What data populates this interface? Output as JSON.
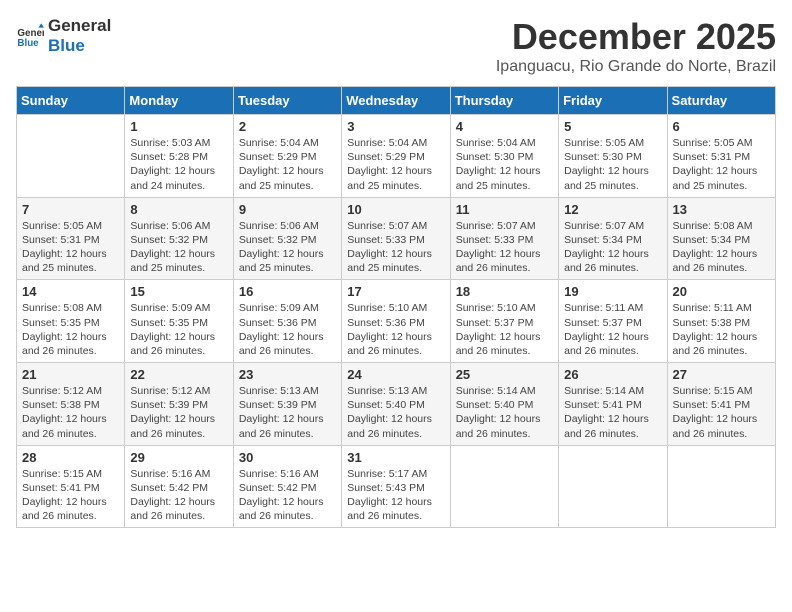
{
  "logo": {
    "line1": "General",
    "line2": "Blue"
  },
  "title": "December 2025",
  "location": "Ipanguacu, Rio Grande do Norte, Brazil",
  "header_days": [
    "Sunday",
    "Monday",
    "Tuesday",
    "Wednesday",
    "Thursday",
    "Friday",
    "Saturday"
  ],
  "weeks": [
    [
      {
        "day": "",
        "info": ""
      },
      {
        "day": "1",
        "info": "Sunrise: 5:03 AM\nSunset: 5:28 PM\nDaylight: 12 hours\nand 24 minutes."
      },
      {
        "day": "2",
        "info": "Sunrise: 5:04 AM\nSunset: 5:29 PM\nDaylight: 12 hours\nand 25 minutes."
      },
      {
        "day": "3",
        "info": "Sunrise: 5:04 AM\nSunset: 5:29 PM\nDaylight: 12 hours\nand 25 minutes."
      },
      {
        "day": "4",
        "info": "Sunrise: 5:04 AM\nSunset: 5:30 PM\nDaylight: 12 hours\nand 25 minutes."
      },
      {
        "day": "5",
        "info": "Sunrise: 5:05 AM\nSunset: 5:30 PM\nDaylight: 12 hours\nand 25 minutes."
      },
      {
        "day": "6",
        "info": "Sunrise: 5:05 AM\nSunset: 5:31 PM\nDaylight: 12 hours\nand 25 minutes."
      }
    ],
    [
      {
        "day": "7",
        "info": "Sunrise: 5:05 AM\nSunset: 5:31 PM\nDaylight: 12 hours\nand 25 minutes."
      },
      {
        "day": "8",
        "info": "Sunrise: 5:06 AM\nSunset: 5:32 PM\nDaylight: 12 hours\nand 25 minutes."
      },
      {
        "day": "9",
        "info": "Sunrise: 5:06 AM\nSunset: 5:32 PM\nDaylight: 12 hours\nand 25 minutes."
      },
      {
        "day": "10",
        "info": "Sunrise: 5:07 AM\nSunset: 5:33 PM\nDaylight: 12 hours\nand 25 minutes."
      },
      {
        "day": "11",
        "info": "Sunrise: 5:07 AM\nSunset: 5:33 PM\nDaylight: 12 hours\nand 26 minutes."
      },
      {
        "day": "12",
        "info": "Sunrise: 5:07 AM\nSunset: 5:34 PM\nDaylight: 12 hours\nand 26 minutes."
      },
      {
        "day": "13",
        "info": "Sunrise: 5:08 AM\nSunset: 5:34 PM\nDaylight: 12 hours\nand 26 minutes."
      }
    ],
    [
      {
        "day": "14",
        "info": "Sunrise: 5:08 AM\nSunset: 5:35 PM\nDaylight: 12 hours\nand 26 minutes."
      },
      {
        "day": "15",
        "info": "Sunrise: 5:09 AM\nSunset: 5:35 PM\nDaylight: 12 hours\nand 26 minutes."
      },
      {
        "day": "16",
        "info": "Sunrise: 5:09 AM\nSunset: 5:36 PM\nDaylight: 12 hours\nand 26 minutes."
      },
      {
        "day": "17",
        "info": "Sunrise: 5:10 AM\nSunset: 5:36 PM\nDaylight: 12 hours\nand 26 minutes."
      },
      {
        "day": "18",
        "info": "Sunrise: 5:10 AM\nSunset: 5:37 PM\nDaylight: 12 hours\nand 26 minutes."
      },
      {
        "day": "19",
        "info": "Sunrise: 5:11 AM\nSunset: 5:37 PM\nDaylight: 12 hours\nand 26 minutes."
      },
      {
        "day": "20",
        "info": "Sunrise: 5:11 AM\nSunset: 5:38 PM\nDaylight: 12 hours\nand 26 minutes."
      }
    ],
    [
      {
        "day": "21",
        "info": "Sunrise: 5:12 AM\nSunset: 5:38 PM\nDaylight: 12 hours\nand 26 minutes."
      },
      {
        "day": "22",
        "info": "Sunrise: 5:12 AM\nSunset: 5:39 PM\nDaylight: 12 hours\nand 26 minutes."
      },
      {
        "day": "23",
        "info": "Sunrise: 5:13 AM\nSunset: 5:39 PM\nDaylight: 12 hours\nand 26 minutes."
      },
      {
        "day": "24",
        "info": "Sunrise: 5:13 AM\nSunset: 5:40 PM\nDaylight: 12 hours\nand 26 minutes."
      },
      {
        "day": "25",
        "info": "Sunrise: 5:14 AM\nSunset: 5:40 PM\nDaylight: 12 hours\nand 26 minutes."
      },
      {
        "day": "26",
        "info": "Sunrise: 5:14 AM\nSunset: 5:41 PM\nDaylight: 12 hours\nand 26 minutes."
      },
      {
        "day": "27",
        "info": "Sunrise: 5:15 AM\nSunset: 5:41 PM\nDaylight: 12 hours\nand 26 minutes."
      }
    ],
    [
      {
        "day": "28",
        "info": "Sunrise: 5:15 AM\nSunset: 5:41 PM\nDaylight: 12 hours\nand 26 minutes."
      },
      {
        "day": "29",
        "info": "Sunrise: 5:16 AM\nSunset: 5:42 PM\nDaylight: 12 hours\nand 26 minutes."
      },
      {
        "day": "30",
        "info": "Sunrise: 5:16 AM\nSunset: 5:42 PM\nDaylight: 12 hours\nand 26 minutes."
      },
      {
        "day": "31",
        "info": "Sunrise: 5:17 AM\nSunset: 5:43 PM\nDaylight: 12 hours\nand 26 minutes."
      },
      {
        "day": "",
        "info": ""
      },
      {
        "day": "",
        "info": ""
      },
      {
        "day": "",
        "info": ""
      }
    ]
  ]
}
